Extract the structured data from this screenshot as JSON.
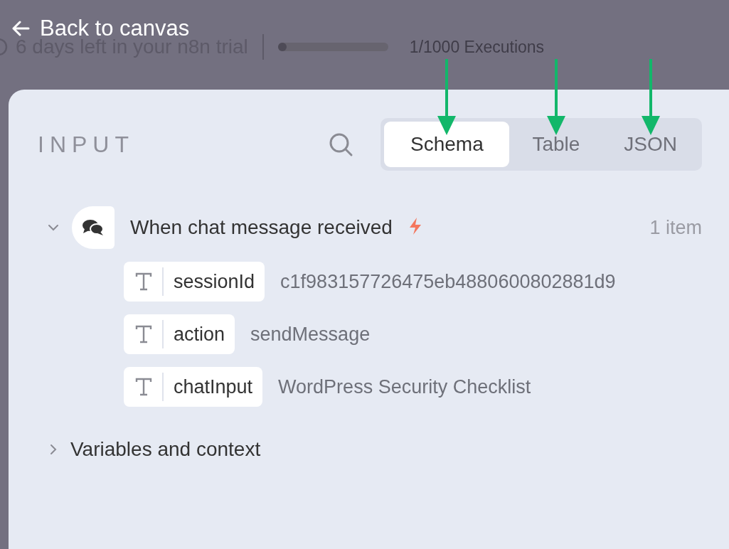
{
  "header": {
    "back": {
      "label": "Back to canvas"
    },
    "trial": {
      "text": "6 days left in your n8n trial",
      "level": 0.03,
      "executions": "1/1000 Executions"
    }
  },
  "panel": {
    "title": "INPUT",
    "tabs": [
      {
        "label": "Schema",
        "selected": true,
        "arrow": true
      },
      {
        "label": "Table",
        "selected": false,
        "arrow": true
      },
      {
        "label": "JSON",
        "selected": false,
        "arrow": true
      }
    ],
    "node": {
      "name": "When chat message received",
      "expanded": true,
      "count": "1 item",
      "fields": [
        {
          "name": "sessionId",
          "value": "c1f983157726475eb4880600802881d9"
        },
        {
          "name": "action",
          "value": "sendMessage"
        },
        {
          "name": "chatInput",
          "value": "WordPress Security Checklist"
        }
      ]
    },
    "variables": {
      "label": "Variables and context",
      "expanded": false
    }
  }
}
